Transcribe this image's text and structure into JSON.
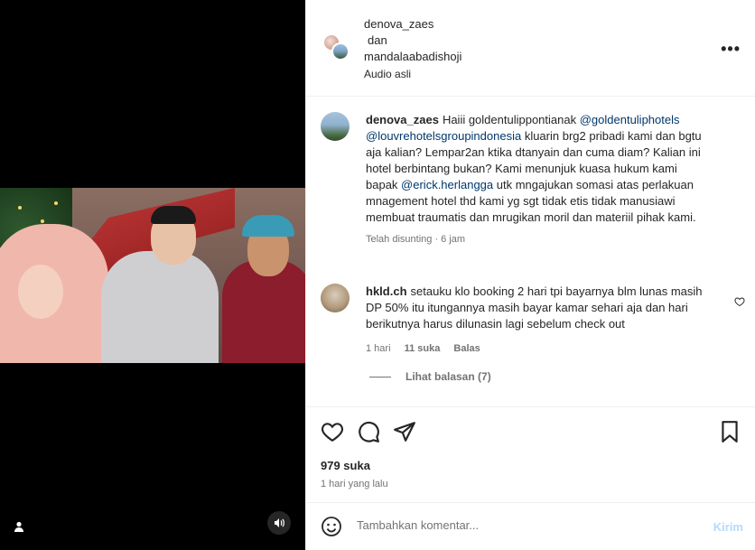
{
  "header": {
    "user1": "denova_zaes",
    "connector": "dan",
    "user2": "mandalaabadishoji",
    "audio": "Audio asli",
    "more_icon": "more-horizontal-icon"
  },
  "caption": {
    "username": "denova_zaes",
    "text_parts": [
      {
        "t": "Haiii goldentulippontianak ",
        "m": false
      },
      {
        "t": "@goldentuliphotels",
        "m": true
      },
      {
        "t": " ",
        "m": false
      },
      {
        "t": "@louvrehotelsgroupindonesia",
        "m": true
      },
      {
        "t": " kluarin brg2 pribadi kami dan bgtu aja kalian? Lempar2an ktika dtanyain dan cuma diam? Kalian ini hotel berbintang bukan? Kami menunjuk kuasa hukum kami bapak ",
        "m": false
      },
      {
        "t": "@erick.herlangga",
        "m": true
      },
      {
        "t": " utk mngajukan somasi atas perlakuan mnagement hotel thd kami yg sgt tidak etis tidak manusiawi membuat traumatis dan mrugikan moril dan materiil pihak kami.",
        "m": false
      }
    ],
    "edited": "Telah disunting",
    "time": "6 jam"
  },
  "comment": {
    "username": "hkld.ch",
    "text": "setauku klo booking 2 hari tpi bayarnya blm lunas masih DP 50% itu itungannya masih bayar kamar sehari aja dan hari berikutnya harus dilunasin lagi sebelum check out",
    "time": "1 hari",
    "likes": "11 suka",
    "reply": "Balas",
    "view_replies": "Lihat balasan (7)"
  },
  "actions": {
    "likes": "979 suka",
    "time": "1 hari yang lalu"
  },
  "composer": {
    "placeholder": "Tambahkan komentar...",
    "send": "Kirim"
  }
}
